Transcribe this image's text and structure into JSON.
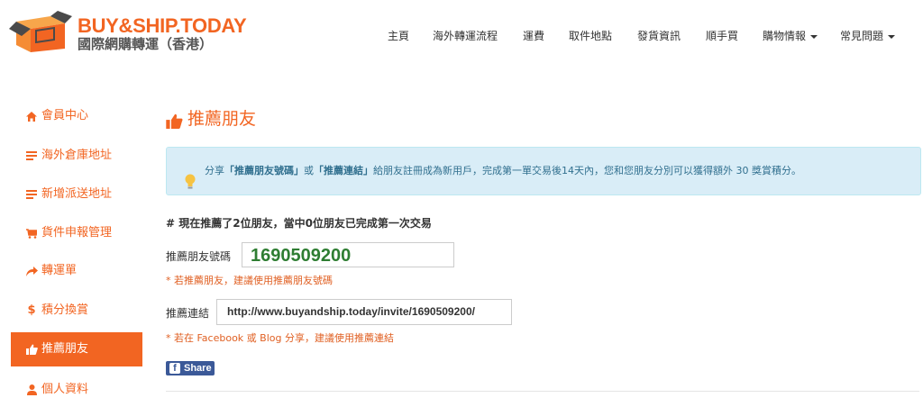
{
  "header": {
    "brand": "BUY&SHIP.TODAY",
    "tagline": "國際網購轉運（香港）",
    "nav": [
      {
        "label": "主頁",
        "dropdown": false
      },
      {
        "label": "海外轉運流程",
        "dropdown": false
      },
      {
        "label": "運費",
        "dropdown": false
      },
      {
        "label": "取件地點",
        "dropdown": false
      },
      {
        "label": "發貨資訊",
        "dropdown": false
      },
      {
        "label": "順手買",
        "dropdown": false
      },
      {
        "label": "購物情報",
        "dropdown": true
      },
      {
        "label": "常見問題",
        "dropdown": true
      }
    ]
  },
  "sidebar": {
    "items": [
      {
        "label": "會員中心",
        "icon": "home-icon",
        "active": false
      },
      {
        "label": "海外倉庫地址",
        "icon": "list-icon",
        "active": false
      },
      {
        "label": "新增派送地址",
        "icon": "list-icon",
        "active": false
      },
      {
        "label": "貨件申報管理",
        "icon": "cart-icon",
        "active": false
      },
      {
        "label": "轉運單",
        "icon": "share-arrow-icon",
        "active": false
      },
      {
        "label": "積分換賞",
        "icon": "dollar-icon",
        "active": false
      },
      {
        "label": "推薦朋友",
        "icon": "thumbs-up-icon",
        "active": true
      },
      {
        "label": "個人資料",
        "icon": "user-icon",
        "active": false
      }
    ]
  },
  "main": {
    "title": "推薦朋友",
    "alert": {
      "t1": "分享",
      "b1": "「推薦朋友號碼」",
      "t2": "或",
      "b2": "「推薦連結」",
      "t3": "給朋友註冊成為新用戶，完成第一單交易後14天內，您和您朋友分別可以獲得額外 30 獎賞積分。"
    },
    "summary": "# 現在推薦了2位朋友，當中0位朋友已完成第一次交易",
    "code_label": "推薦朋友號碼",
    "code_value": "1690509200",
    "code_hint": "* 若推薦朋友，建議使用推薦朋友號碼",
    "link_label": "推薦連結",
    "link_value": "http://www.buyandship.today/invite/1690509200/",
    "link_hint": "* 若在 Facebook 或 Blog 分享，建議使用推薦連結",
    "share_label": "Share"
  },
  "colors": {
    "brand": "#f26522",
    "code_green": "#2e7d32",
    "alert_bg": "#d9edf7",
    "facebook": "#3b5998"
  }
}
